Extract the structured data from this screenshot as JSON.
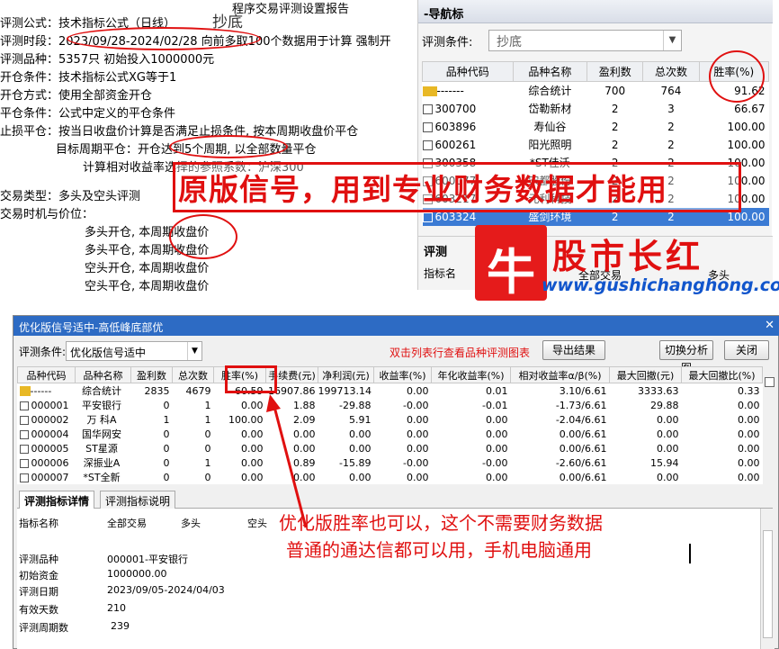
{
  "report": {
    "title": "程序交易评测设置报告",
    "lines": [
      "评测公式：技术指标公式（日线）",
      "评测时段：2023/09/28-2024/02/28 向前多取100个数据用于计算 强制开",
      "评测品种：5357只 初始投入1000000元",
      "开仓条件：技术指标公式XG等于1",
      "开仓方式：使用全部资金开仓",
      "平仓条件：公式中定义的平仓条件",
      "止损平仓：按当日收盘价计算是否满足止损条件, 按本周期收盘价平仓",
      "目标周期平仓：开仓达到5个周期, 以全部数量平仓",
      "计算相对收益率选择的参照系数：沪深300",
      "交易类型：多头及空头评测",
      "交易时机与价位：",
      "多头开仓, 本周期收盘价",
      "多头平仓, 本周期收盘价",
      "空头开仓, 本周期收盘价",
      "空头平仓, 本周期收盘价"
    ],
    "handwritten": "抄底"
  },
  "nav": {
    "title": "-导航标",
    "cond_label": "评测条件:",
    "cond_value": "抄底",
    "headers": [
      "品种代码",
      "品种名称",
      "盈利数",
      "总次数",
      "胜率(%)"
    ],
    "rows": [
      {
        "code": "-------",
        "name": "综合统计",
        "win": "700",
        "total": "764",
        "rate": "91.62"
      },
      {
        "code": "300700",
        "name": "岱勒新材",
        "win": "2",
        "total": "3",
        "rate": "66.67"
      },
      {
        "code": "603896",
        "name": "寿仙谷",
        "win": "2",
        "total": "2",
        "rate": "100.00"
      },
      {
        "code": "600261",
        "name": "阳光照明",
        "win": "2",
        "total": "2",
        "rate": "100.00"
      },
      {
        "code": "300358",
        "name": "*ST佳沃",
        "win": "2",
        "total": "2",
        "rate": "100.00"
      },
      {
        "code": "600077",
        "name": "宋都股份",
        "win": "2",
        "total": "2",
        "rate": "100.00"
      },
      {
        "code": "603217",
        "name": "元利科技",
        "win": "2",
        "total": "2",
        "rate": "100.00"
      },
      {
        "code": "603324",
        "name": "盛剑环境",
        "win": "2",
        "total": "2",
        "rate": "100.00"
      }
    ],
    "panel_title": "评测",
    "panel_label": "指标名",
    "panel_all": "全部交易",
    "panel_long": "多头"
  },
  "annotation_top": "原版信号，用到专业财务数据才能用",
  "logo": {
    "char": "牛",
    "name": "股市长红",
    "url": "www.gushichanghong.com"
  },
  "bottom": {
    "title": "优化版信号适中-高低峰底部优",
    "cond_label": "评测条件:",
    "cond_value": "优化版信号适中",
    "hint": "双击列表行查看品种评测图表",
    "btn_export": "导出结果",
    "btn_switch": "切换分析图",
    "btn_close": "关闭",
    "headers": [
      "品种代码",
      "品种名称",
      "盈利数",
      "总次数",
      "胜率(%)",
      "手续费(元)",
      "净利润(元)",
      "收益率(%)",
      "年化收益率(%)",
      "相对收益率α/β(%)",
      "最大回撤(元)",
      "最大回撤比(%)"
    ],
    "rows": [
      [
        "------",
        "综合统计",
        "2835",
        "4679",
        "60.59",
        "16907.86",
        "199713.14",
        "0.00",
        "0.01",
        "3.10/6.61",
        "3333.63",
        "0.33"
      ],
      [
        "000001",
        "平安银行",
        "0",
        "1",
        "0.00",
        "1.88",
        "-29.88",
        "-0.00",
        "-0.01",
        "-1.73/6.61",
        "29.88",
        "0.00"
      ],
      [
        "000002",
        "万 科A",
        "1",
        "1",
        "100.00",
        "2.09",
        "5.91",
        "0.00",
        "0.00",
        "-2.04/6.61",
        "0.00",
        "0.00"
      ],
      [
        "000004",
        "国华网安",
        "0",
        "0",
        "0.00",
        "0.00",
        "0.00",
        "0.00",
        "0.00",
        "0.00/6.61",
        "0.00",
        "0.00"
      ],
      [
        "000005",
        "ST星源",
        "0",
        "0",
        "0.00",
        "0.00",
        "0.00",
        "0.00",
        "0.00",
        "0.00/6.61",
        "0.00",
        "0.00"
      ],
      [
        "000006",
        "深振业A",
        "0",
        "1",
        "0.00",
        "0.89",
        "-15.89",
        "-0.00",
        "-0.00",
        "-2.60/6.61",
        "15.94",
        "0.00"
      ],
      [
        "000007",
        "*ST全新",
        "0",
        "0",
        "0.00",
        "0.00",
        "0.00",
        "0.00",
        "0.00",
        "0.00/6.61",
        "0.00",
        "0.00"
      ]
    ],
    "tab1": "评测指标详情",
    "tab2": "评测指标说明",
    "detail": {
      "h_name": "指标名称",
      "h_all": "全部交易",
      "h_long": "多头",
      "h_short": "空头",
      "rows": [
        {
          "k": "评测品种",
          "v": "000001-平安银行"
        },
        {
          "k": "初始资金",
          "v": "1000000.00"
        },
        {
          "k": "评测日期",
          "v": "2023/09/05-2024/04/03"
        },
        {
          "k": "有效天数",
          "v": "210"
        },
        {
          "k": "评测周期数",
          "v": "239"
        }
      ]
    }
  },
  "annotation_bottom": [
    "优化版胜率也可以，这个不需要财务数据",
    "普通的通达信都可以用，手机电脑通用"
  ]
}
